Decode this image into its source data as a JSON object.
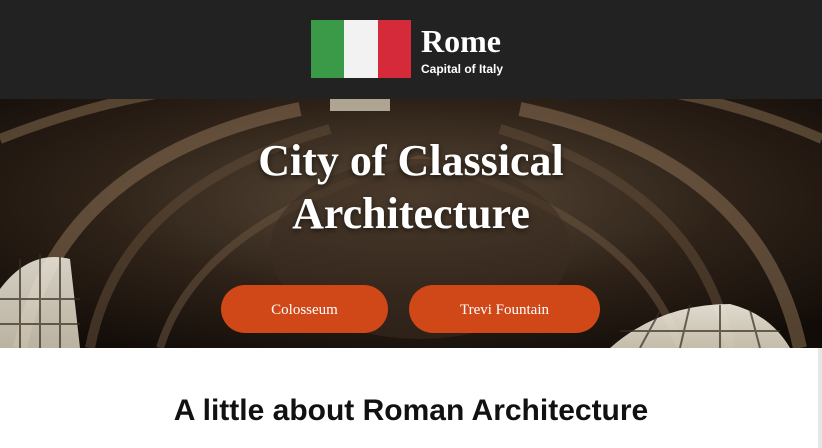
{
  "header": {
    "title": "Rome",
    "subtitle": "Capital of Italy",
    "flag": {
      "colors": [
        "#3a9a48",
        "#f2f2f2",
        "#d42a3a"
      ]
    },
    "background": "#222222"
  },
  "hero": {
    "title": "City of Classical Architecture",
    "buttons": [
      {
        "label": "Colosseum"
      },
      {
        "label": "Trevi Fountain"
      }
    ],
    "accent": "#d14818"
  },
  "main": {
    "heading": "A little about Roman Architecture"
  }
}
